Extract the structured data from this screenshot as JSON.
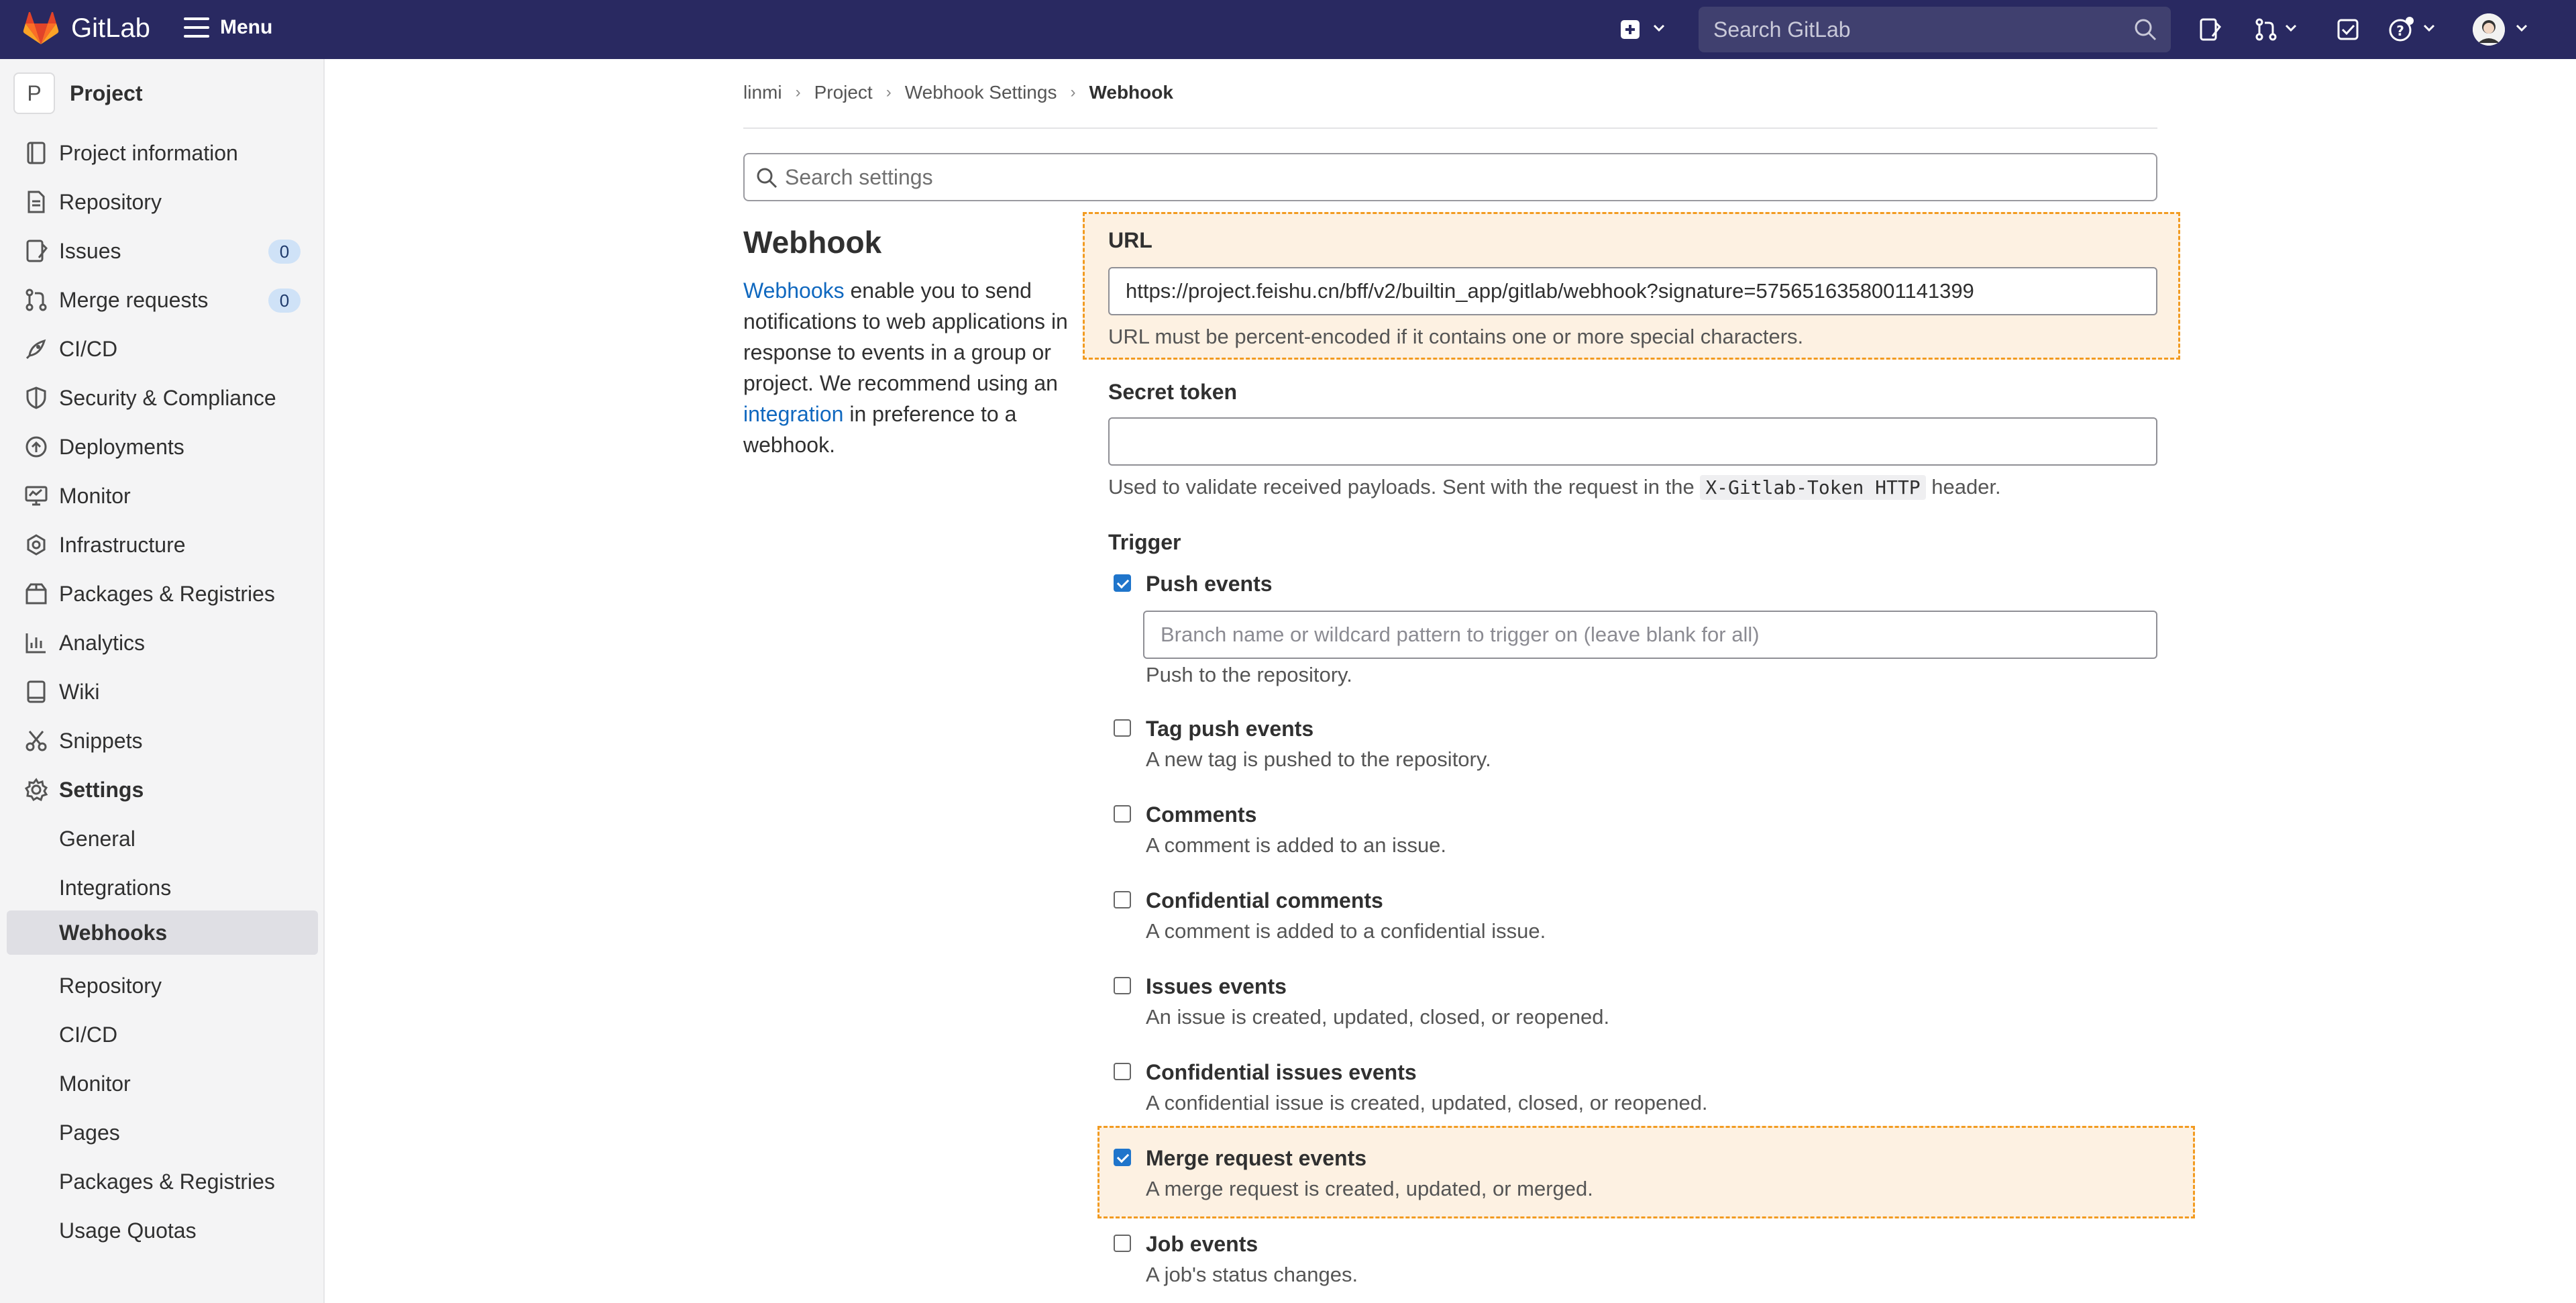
{
  "topbar": {
    "brand": "GitLab",
    "menu_label": "Menu",
    "search_placeholder": "Search GitLab",
    "icons": [
      "create-new-icon",
      "issues-icon",
      "merge-requests-icon",
      "todos-icon",
      "help-icon",
      "avatar"
    ]
  },
  "sidebar": {
    "project_initial": "P",
    "project_name": "Project",
    "items": [
      {
        "label": "Project information",
        "icon": "info-icon"
      },
      {
        "label": "Repository",
        "icon": "doc-icon"
      },
      {
        "label": "Issues",
        "icon": "issues-icon",
        "count": "0"
      },
      {
        "label": "Merge requests",
        "icon": "merge-icon",
        "count": "0"
      },
      {
        "label": "CI/CD",
        "icon": "rocket-icon"
      },
      {
        "label": "Security & Compliance",
        "icon": "shield-icon"
      },
      {
        "label": "Deployments",
        "icon": "deploy-icon"
      },
      {
        "label": "Monitor",
        "icon": "monitor-icon"
      },
      {
        "label": "Infrastructure",
        "icon": "cloud-icon"
      },
      {
        "label": "Packages & Registries",
        "icon": "package-icon"
      },
      {
        "label": "Analytics",
        "icon": "chart-icon"
      },
      {
        "label": "Wiki",
        "icon": "book-icon"
      },
      {
        "label": "Snippets",
        "icon": "scissors-icon"
      },
      {
        "label": "Settings",
        "icon": "gear-icon"
      }
    ],
    "settings_sub": [
      {
        "label": "General"
      },
      {
        "label": "Integrations"
      },
      {
        "label": "Webhooks",
        "active": true
      },
      {
        "label": "Repository"
      },
      {
        "label": "CI/CD"
      },
      {
        "label": "Monitor"
      },
      {
        "label": "Pages"
      },
      {
        "label": "Packages & Registries"
      },
      {
        "label": "Usage Quotas"
      }
    ]
  },
  "breadcrumb": [
    "linmi",
    "Project",
    "Webhook Settings",
    "Webhook"
  ],
  "settings_search_placeholder": "Search settings",
  "webhook": {
    "title": "Webhook",
    "desc_link1": "Webhooks",
    "desc_part1": " enable you to send notifications to web applications in response to events in a group or project. We recommend using an ",
    "desc_link2": "integration",
    "desc_part2": " in preference to a webhook.",
    "url_label": "URL",
    "url_value": "https://project.feishu.cn/bff/v2/builtin_app/gitlab/webhook?signature=5756516358001141399",
    "url_help": "URL must be percent-encoded if it contains one or more special characters.",
    "token_label": "Secret token",
    "token_value": "",
    "token_help_pre": "Used to validate received payloads. Sent with the request in the ",
    "token_help_code": "X-Gitlab-Token HTTP",
    "token_help_post": " header.",
    "trigger_label": "Trigger",
    "branch_placeholder": "Branch name or wildcard pattern to trigger on (leave blank for all)",
    "events": [
      {
        "title": "Push events",
        "help": "Push to the repository.",
        "checked": true
      },
      {
        "title": "Tag push events",
        "help": "A new tag is pushed to the repository.",
        "checked": false
      },
      {
        "title": "Comments",
        "help": "A comment is added to an issue.",
        "checked": false
      },
      {
        "title": "Confidential comments",
        "help": "A comment is added to a confidential issue.",
        "checked": false
      },
      {
        "title": "Issues events",
        "help": "An issue is created, updated, closed, or reopened.",
        "checked": false
      },
      {
        "title": "Confidential issues events",
        "help": "A confidential issue is created, updated, closed, or reopened.",
        "checked": false
      },
      {
        "title": "Merge request events",
        "help": "A merge request is created, updated, or merged.",
        "checked": true
      },
      {
        "title": "Job events",
        "help": "A job's status changes.",
        "checked": false
      }
    ]
  },
  "colors": {
    "topbar": "#292961",
    "accent": "#1f75cb",
    "highlight_border": "#f29b21",
    "highlight_bg": "#fdf1e2",
    "link": "#1068bf"
  }
}
